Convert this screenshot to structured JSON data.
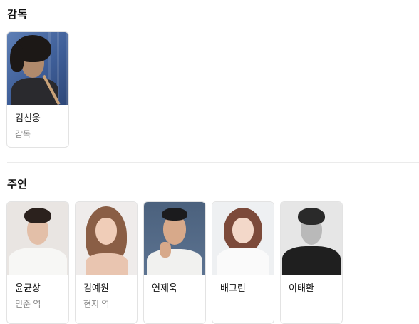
{
  "sections": {
    "director": {
      "title": "감독",
      "people": [
        {
          "name": "김선웅",
          "role": "감독",
          "photo": "director-portrait"
        }
      ]
    },
    "cast": {
      "title": "주연",
      "people": [
        {
          "name": "윤균상",
          "role": "민준 역",
          "photo": "actor-portrait"
        },
        {
          "name": "김예원",
          "role": "현지 역",
          "photo": "actress-portrait"
        },
        {
          "name": "연제욱",
          "role": "",
          "photo": "actor-portrait"
        },
        {
          "name": "배그린",
          "role": "",
          "photo": "actress-portrait"
        },
        {
          "name": "이태환",
          "role": "",
          "photo": "actor-portrait"
        }
      ]
    }
  }
}
